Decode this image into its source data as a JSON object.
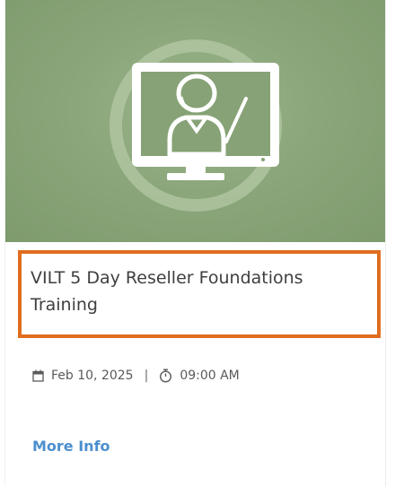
{
  "course": {
    "title": "VILT 5 Day Reseller Foundations Training",
    "date": "Feb 10, 2025",
    "separator": "|",
    "time": "09:00 AM",
    "more_info_label": "More Info"
  },
  "icons": {
    "hero": "virtual-instructor-monitor-icon",
    "date": "calendar-icon",
    "time": "stopwatch-icon"
  },
  "colors": {
    "hero_background": "#8aa67a",
    "highlight_border": "#e06d1f",
    "link": "#4c8fce",
    "title_text": "#3f3f3f"
  }
}
